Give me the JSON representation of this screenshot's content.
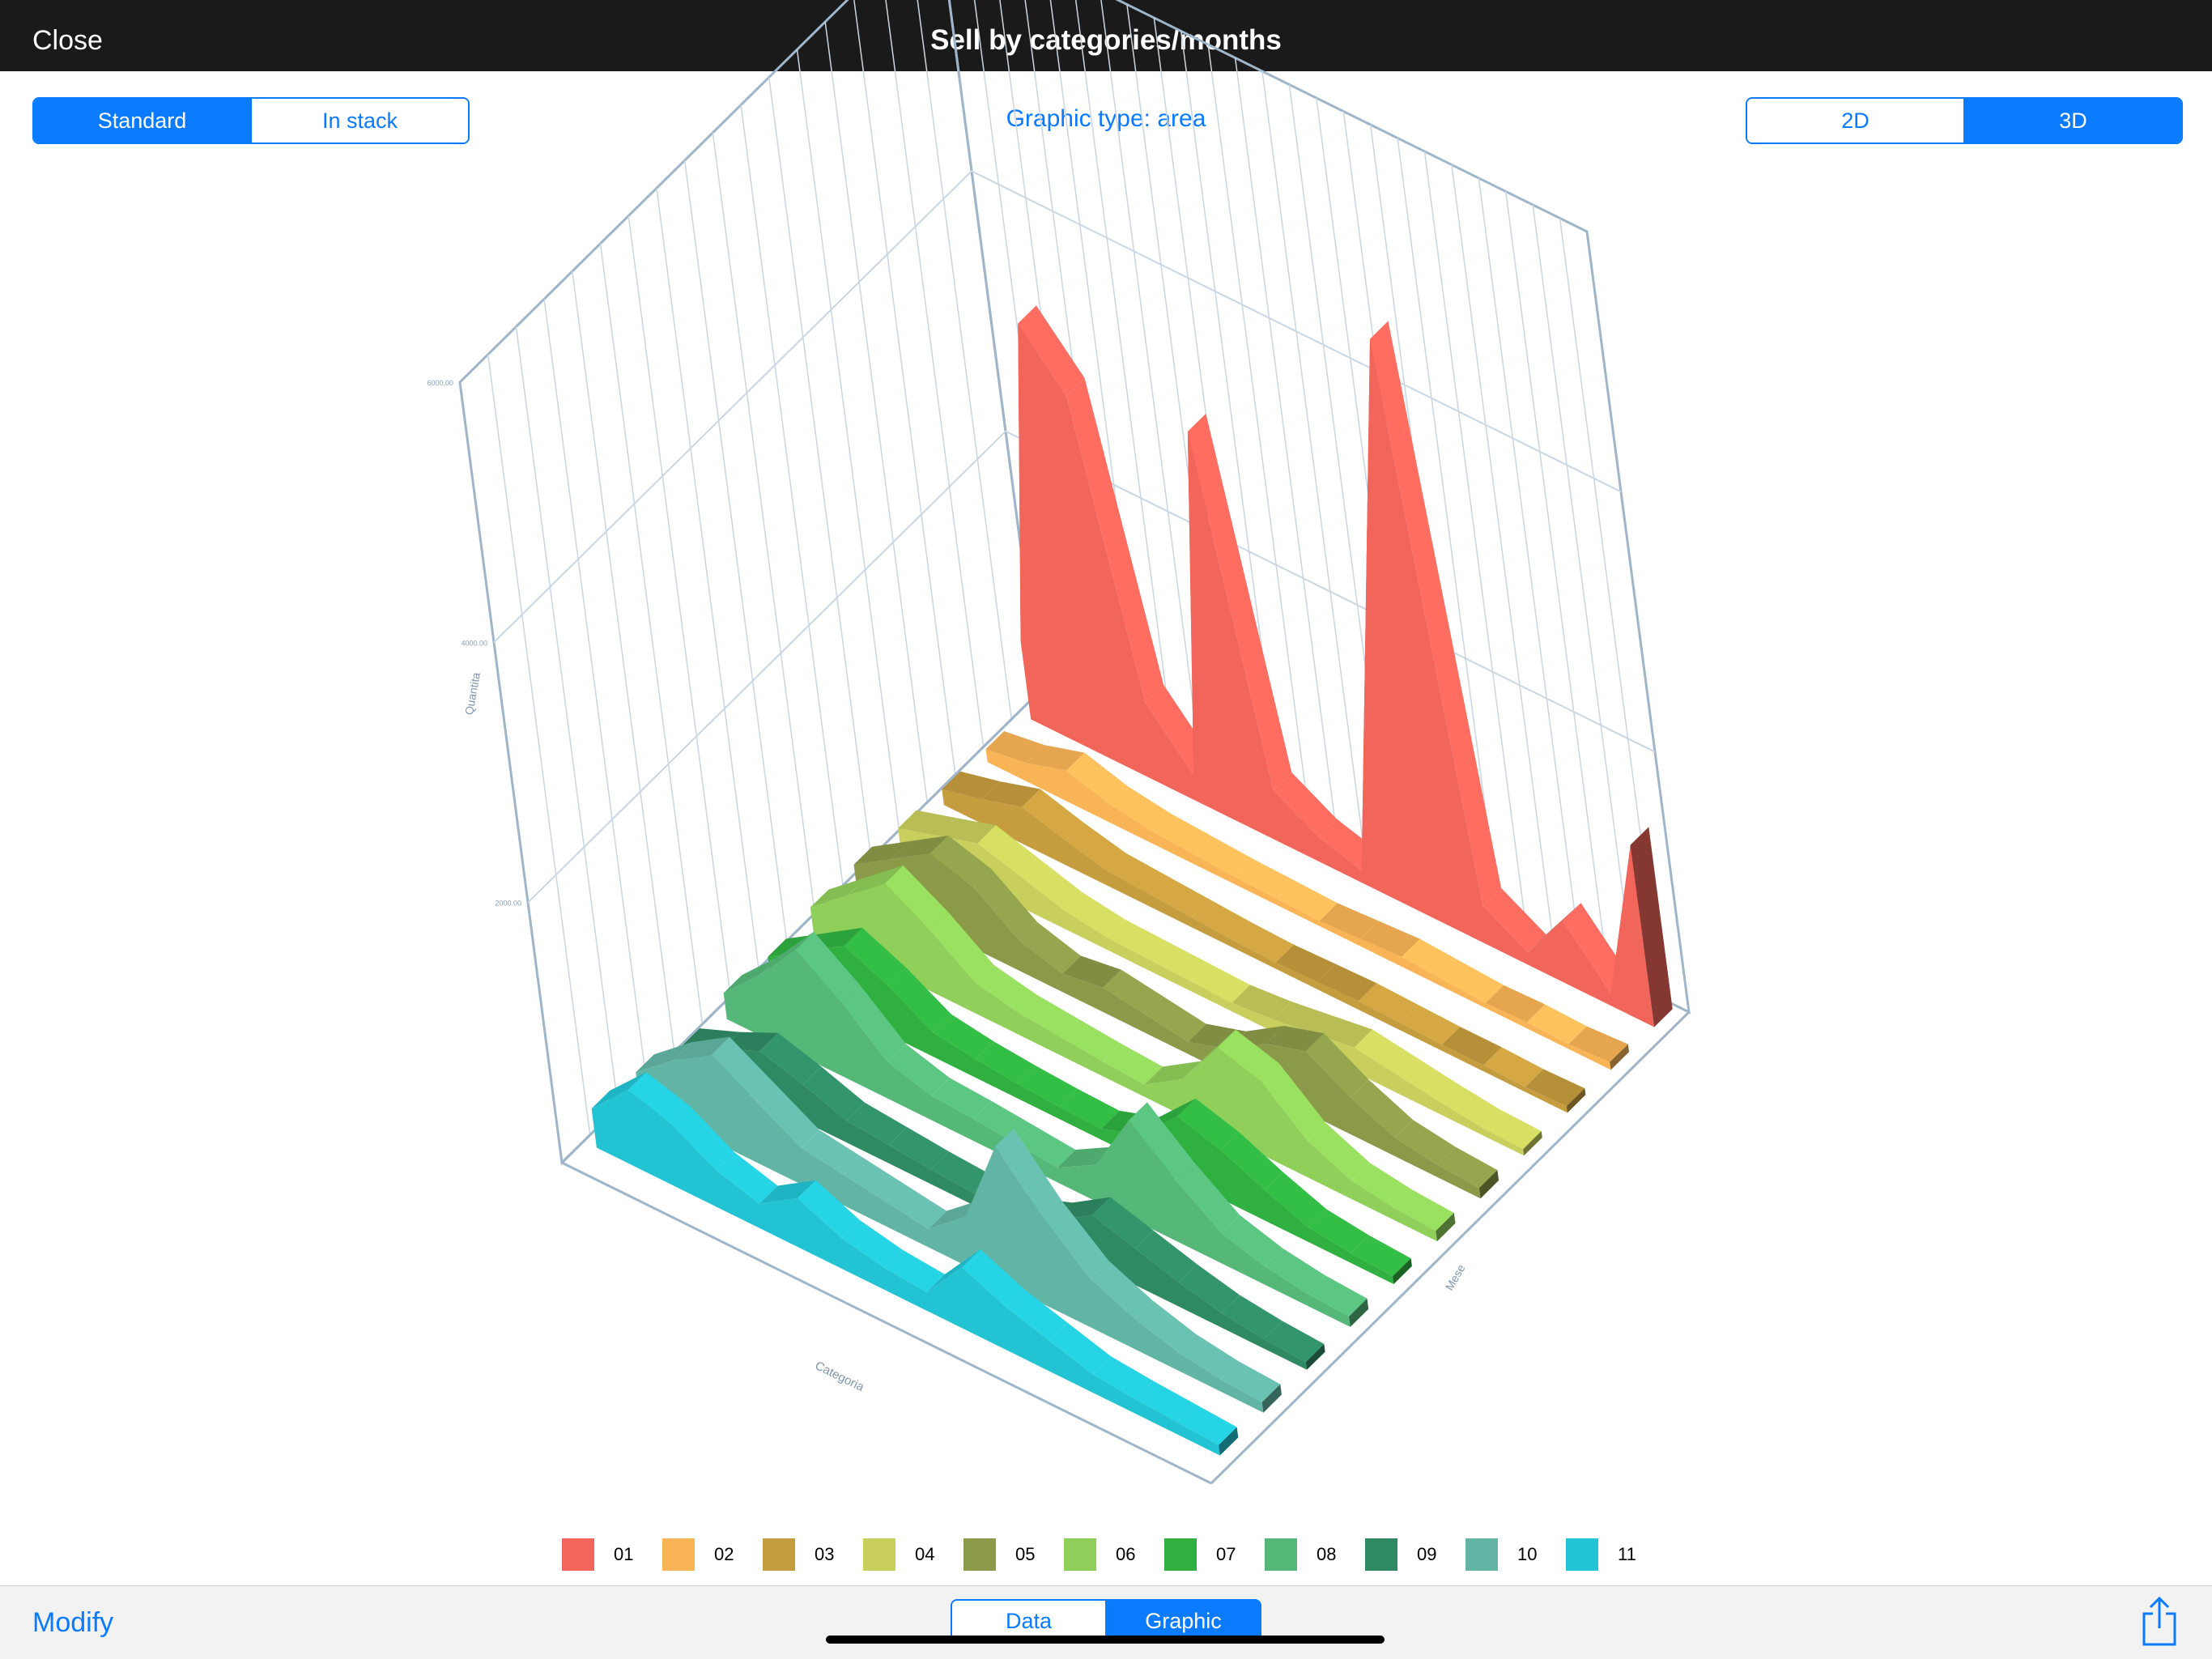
{
  "header": {
    "close_label": "Close",
    "title": "Sell by categories/months"
  },
  "controls": {
    "mode": {
      "options": [
        "Standard",
        "In stack"
      ],
      "selected": "Standard"
    },
    "graphic_type_label": "Graphic type: area",
    "dimension": {
      "options": [
        "2D",
        "3D"
      ],
      "selected": "3D"
    }
  },
  "footer": {
    "modify_label": "Modify",
    "view": {
      "options": [
        "Data",
        "Graphic"
      ],
      "selected": "Graphic"
    },
    "share_icon": "share-icon"
  },
  "chart_data": {
    "type": "area",
    "render": "3d",
    "title": "",
    "ylabel": "Quantita",
    "xlabel": "Categoria",
    "zlabel": "Mese",
    "y_ticks": [
      "2000.00",
      "4000.00",
      "6000.00"
    ],
    "ylim": [
      0,
      6000
    ],
    "grid": true,
    "legend_position": "bottom",
    "series": [
      {
        "name": "01",
        "color": "#f2655a",
        "values": [
          600,
          3200,
          2800,
          600,
          200,
          3000,
          400,
          200,
          100,
          2300,
          4500,
          300,
          100,
          500,
          100,
          1400
        ]
      },
      {
        "name": "02",
        "color": "#f9b456",
        "values": [
          100,
          150,
          250,
          150,
          100,
          80,
          60,
          50,
          40,
          60,
          80,
          60,
          40,
          50,
          40,
          60
        ]
      },
      {
        "name": "03",
        "color": "#c59c3e",
        "values": [
          120,
          200,
          300,
          200,
          120,
          100,
          80,
          60,
          50,
          60,
          70,
          60,
          50,
          50,
          40,
          50
        ]
      },
      {
        "name": "04",
        "color": "#c8cf5c",
        "values": [
          150,
          250,
          350,
          250,
          150,
          100,
          90,
          80,
          70,
          100,
          150,
          200,
          150,
          100,
          60,
          50
        ]
      },
      {
        "name": "05",
        "color": "#8a9a48",
        "values": [
          200,
          400,
          600,
          500,
          250,
          150,
          200,
          150,
          100,
          200,
          400,
          500,
          300,
          150,
          100,
          80
        ]
      },
      {
        "name": "06",
        "color": "#8fcf5a",
        "values": [
          200,
          450,
          700,
          500,
          250,
          180,
          150,
          120,
          100,
          300,
          700,
          600,
          300,
          150,
          100,
          80
        ]
      },
      {
        "name": "07",
        "color": "#2fb040",
        "values": [
          150,
          350,
          550,
          400,
          200,
          150,
          120,
          100,
          90,
          200,
          500,
          400,
          250,
          120,
          80,
          60
        ]
      },
      {
        "name": "08",
        "color": "#55b878",
        "values": [
          200,
          500,
          850,
          600,
          300,
          200,
          180,
          150,
          120,
          300,
          800,
          500,
          250,
          150,
          100,
          80
        ]
      },
      {
        "name": "09",
        "color": "#2f8a64",
        "values": [
          120,
          250,
          400,
          300,
          180,
          150,
          120,
          100,
          80,
          200,
          400,
          300,
          200,
          120,
          80,
          60
        ]
      },
      {
        "name": "10",
        "color": "#62b5a5",
        "values": [
          250,
          500,
          700,
          500,
          300,
          250,
          200,
          150,
          400,
          1100,
          700,
          400,
          250,
          150,
          100,
          80
        ]
      },
      {
        "name": "11",
        "color": "#22c4d4",
        "values": [
          300,
          600,
          500,
          300,
          200,
          400,
          250,
          180,
          150,
          500,
          350,
          250,
          150,
          120,
          100,
          80
        ]
      }
    ]
  }
}
